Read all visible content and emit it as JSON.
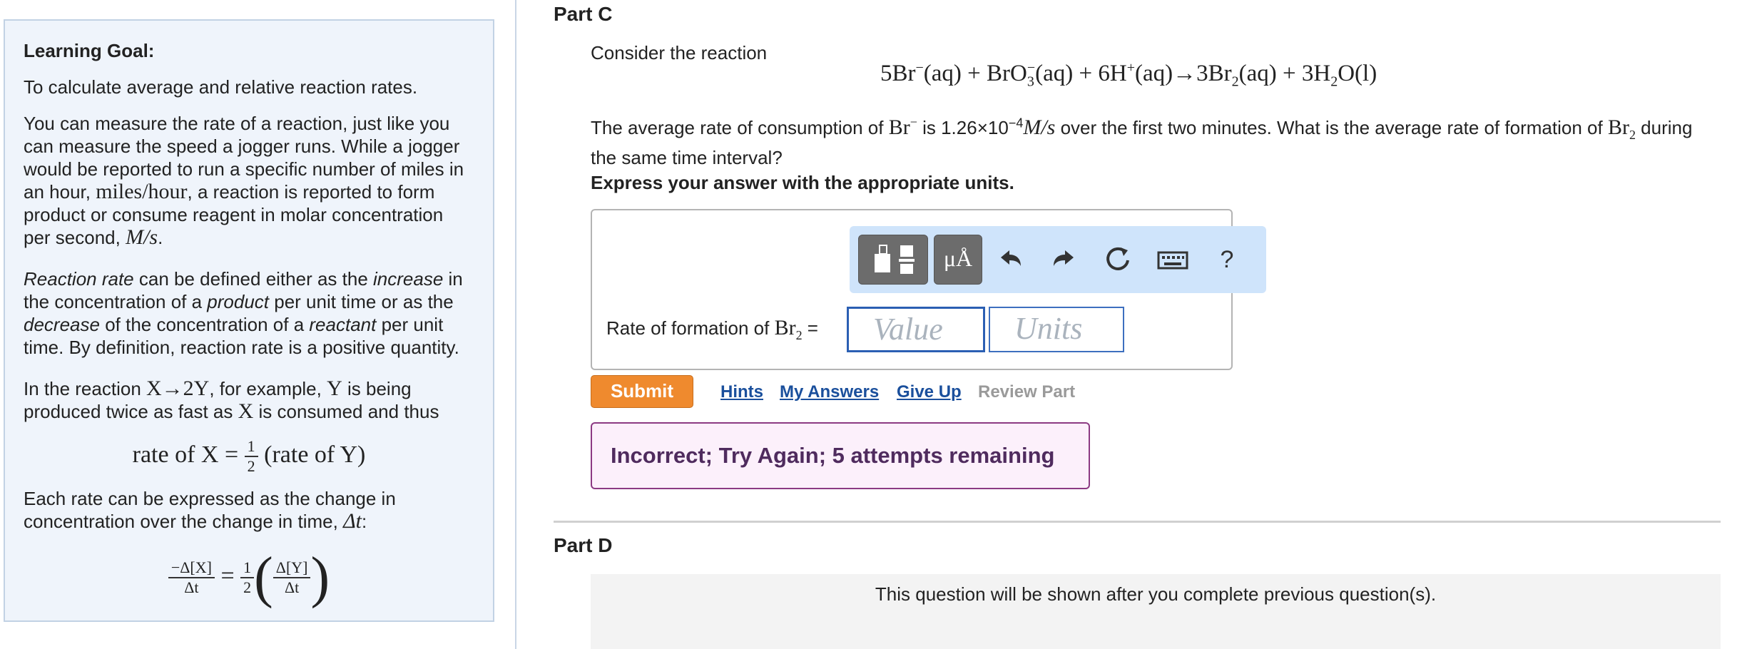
{
  "sidebar": {
    "title": "Learning Goal:",
    "goal": "To calculate average and relative reaction rates.",
    "para1_a": "You can measure the rate of a reaction, just like you can measure the speed a jogger runs. While a jogger would be reported to run a specific number of miles in an hour,",
    "para1_math": "miles/hour",
    "para1_b": ", a reaction is reported to form product or consume reagent in molar concentration per second,",
    "para1_unit": "M/s",
    "para2_a": "Reaction rate",
    "para2_b": " can be defined either as the ",
    "para2_c": "increase",
    "para2_d": " in the concentration of a ",
    "para2_e": "product",
    "para2_f": " per unit time or as the ",
    "para2_g": "decrease",
    "para2_h": " of the concentration of a ",
    "para2_i": "reactant",
    "para2_j": " per unit time. By definition, reaction rate is a positive quantity.",
    "para3_a": "In the reaction",
    "para3_rxn": "X→2Y",
    "para3_b": ", for example,",
    "para3_y": "Y",
    "para3_c": "is being produced twice as fast as",
    "para3_x": "X",
    "para3_d": "is consumed and thus",
    "eq1_left": "rate of X =",
    "eq1_num": "1",
    "eq1_den": "2",
    "eq1_right": "(rate of Y)",
    "para4": "Each rate can be expressed as the change in concentration over the change in time,",
    "para4_dt": "Δt",
    "eq2_num1": "−Δ[X]",
    "eq2_den1": "Δt",
    "eq2_eq": "=",
    "eq2_num2": "1",
    "eq2_den2": "2",
    "eq2_num3": "Δ[Y]",
    "eq2_den3": "Δt"
  },
  "partC": {
    "title": "Part C",
    "consider": "Consider the reaction",
    "question_a": "The average rate of consumption of",
    "question_b": "is 1.26×10",
    "question_exp": "−4",
    "question_unit": "M/s",
    "question_c": "over the first two minutes. What is the average rate of formation of",
    "question_d": "during the same time interval?",
    "instruction": "Express your answer with the appropriate units.",
    "rate_label": "Rate of formation of",
    "value_placeholder": "Value",
    "units_placeholder": "Units",
    "toolbar_units_label": "μÅ",
    "help": "?",
    "submit": "Submit",
    "hints": "Hints",
    "my_answers": "My Answers",
    "give_up": "Give Up",
    "review_part": "Review Part",
    "feedback": "Incorrect; Try Again; 5 attempts remaining"
  },
  "partD": {
    "title": "Part D",
    "locked_message": "This question will be shown after you complete previous question(s)."
  },
  "colors": {
    "submit": "#ef8a2e",
    "link": "#1a4f9c",
    "feedback_border": "#8c3a83",
    "toolbar_bg": "#cfe4fb"
  }
}
